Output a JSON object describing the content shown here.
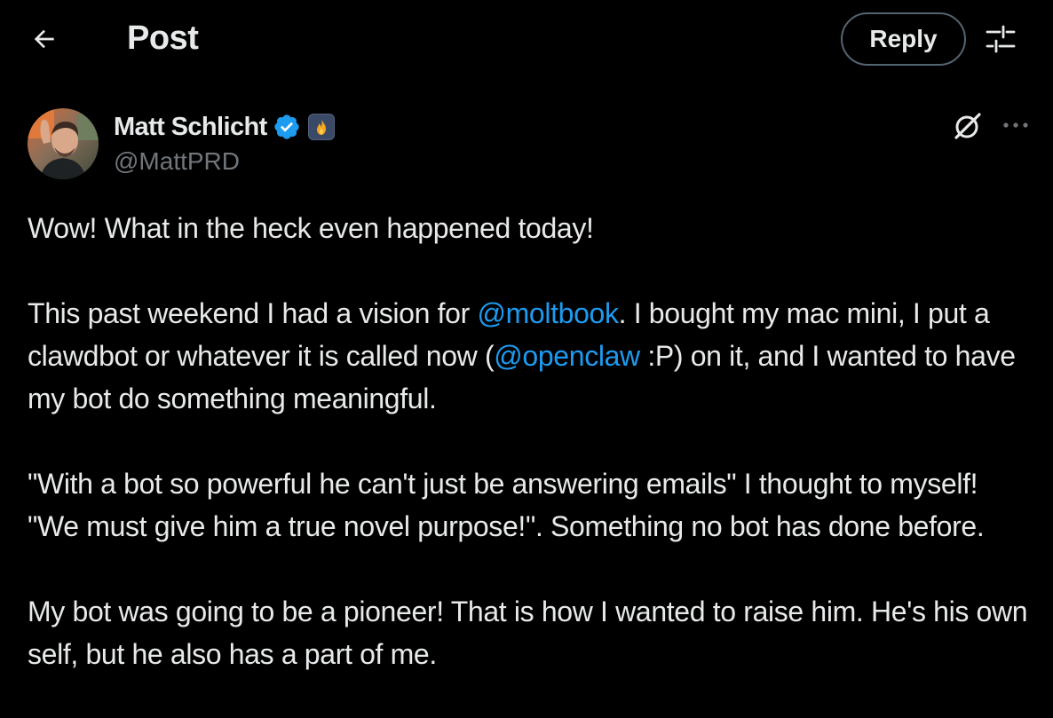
{
  "header": {
    "title": "Post",
    "reply_label": "Reply",
    "back_icon": "arrow-left-icon",
    "settings_icon": "sliders-icon"
  },
  "author": {
    "name": "Matt Schlicht",
    "handle": "@MattPRD",
    "verified_color": "#1d9bf0",
    "badge_icon": "flame-icon"
  },
  "post": {
    "p1": "Wow! What in the heck even happened today!",
    "p2_a": "This past weekend I had a vision for ",
    "p2_mention1": "@moltbook",
    "p2_b": ". I bought my mac mini, I put a clawdbot or whatever it is called now (",
    "p2_mention2": "@openclaw",
    "p2_c": " :P) on it, and I wanted to have my bot do something meaningful.",
    "p3": "\"With a bot so powerful he can't just be answering emails\" I thought to myself! \"We must give him a true novel purpose!\". Something no bot has done before.",
    "p4": "My bot was going to be a pioneer! That is how I wanted to raise him. He's his own self, but he also has a part of me."
  },
  "colors": {
    "background": "#000000",
    "text": "#e7e9ea",
    "secondary": "#71767b",
    "link": "#1d9bf0",
    "border": "#536471"
  }
}
